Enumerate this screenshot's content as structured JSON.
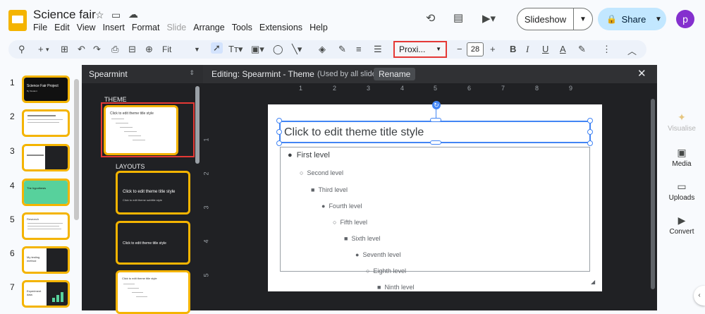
{
  "header": {
    "doc_title": "Science fair",
    "avatar_letter": "p"
  },
  "menu": [
    "File",
    "Edit",
    "View",
    "Insert",
    "Format",
    "Slide",
    "Arrange",
    "Tools",
    "Extensions",
    "Help"
  ],
  "buttons": {
    "slideshow": "Slideshow",
    "share": "Share"
  },
  "toolbar": {
    "zoom_label": "Fit",
    "font_name": "Proxi...",
    "font_size": "28"
  },
  "filmstrip": {
    "slides": [
      {
        "num": "1",
        "title": "Science Fair Project",
        "subtitle": "By Student"
      },
      {
        "num": "2"
      },
      {
        "num": "3"
      },
      {
        "num": "4",
        "title": "The hypothesis"
      },
      {
        "num": "5",
        "title": "Research"
      },
      {
        "num": "6",
        "title": "My testing method"
      },
      {
        "num": "7",
        "title": "Experiment data"
      }
    ]
  },
  "theme_panel": {
    "title": "Spearmint",
    "theme_label": "THEME",
    "layouts_label": "LAYOUTS",
    "theme_card_title": "Click to edit theme title style",
    "layout1_title": "Click to edit theme title style",
    "layout1_sub": "Click to edit theme subtitle style",
    "layout2_title": "Click to edit theme title style",
    "layout3_title": "Click to edit theme title style"
  },
  "editor": {
    "editing_label": "Editing: Spearmint - Theme",
    "used_by": "(Used by all slides)",
    "rename": "Rename",
    "ruler_top": [
      "1",
      "2",
      "3",
      "4",
      "5",
      "6",
      "7",
      "8",
      "9"
    ],
    "ruler_left": [
      "1",
      "2",
      "3",
      "4",
      "5"
    ],
    "slide_title": "Click to edit theme title style",
    "levels": [
      "First level",
      "Second level",
      "Third level",
      "Fourth level",
      "Fifth level",
      "Sixth level",
      "Seventh level",
      "Eighth level",
      "Ninth level"
    ]
  },
  "right_panel": [
    "Visualise",
    "Media",
    "Uploads",
    "Convert"
  ],
  "colors": {
    "accent": "#f4b400",
    "share_bg": "#c2e7ff",
    "highlight": "#e53935",
    "selection": "#4285f4"
  }
}
